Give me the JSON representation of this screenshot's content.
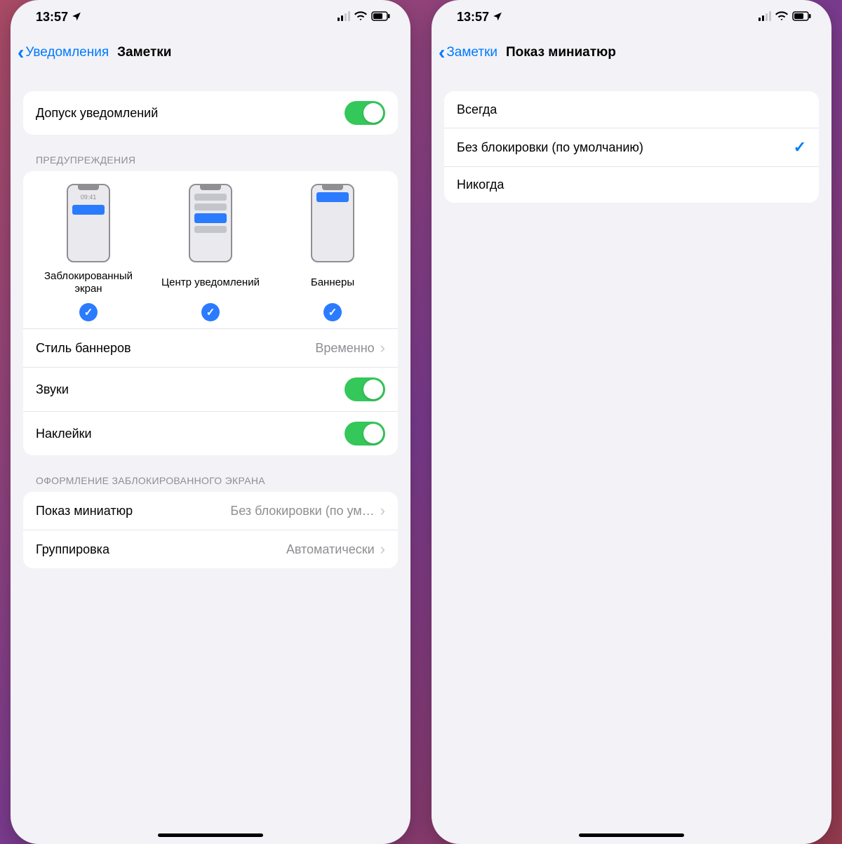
{
  "status": {
    "time": "13:57"
  },
  "left": {
    "back": "Уведомления",
    "title": "Заметки",
    "allow": {
      "label": "Допуск уведомлений",
      "on": true
    },
    "alerts_header": "ПРЕДУПРЕЖДЕНИЯ",
    "previews": {
      "lock": {
        "label": "Заблокированный экран",
        "time": "09:41"
      },
      "center": {
        "label": "Центр уведомлений"
      },
      "banners": {
        "label": "Баннеры"
      }
    },
    "banner_style": {
      "label": "Стиль баннеров",
      "value": "Временно"
    },
    "sounds": {
      "label": "Звуки",
      "on": true
    },
    "badges": {
      "label": "Наклейки",
      "on": true
    },
    "lockscreen_header": "ОФОРМЛЕНИЕ ЗАБЛОКИРОВАННОГО ЭКРАНА",
    "show_previews": {
      "label": "Показ миниатюр",
      "value": "Без блокировки (по ум…"
    },
    "grouping": {
      "label": "Группировка",
      "value": "Автоматически"
    }
  },
  "right": {
    "back": "Заметки",
    "title": "Показ миниатюр",
    "options": {
      "always": "Всегда",
      "unlocked": "Без блокировки (по умолчанию)",
      "never": "Никогда"
    }
  }
}
